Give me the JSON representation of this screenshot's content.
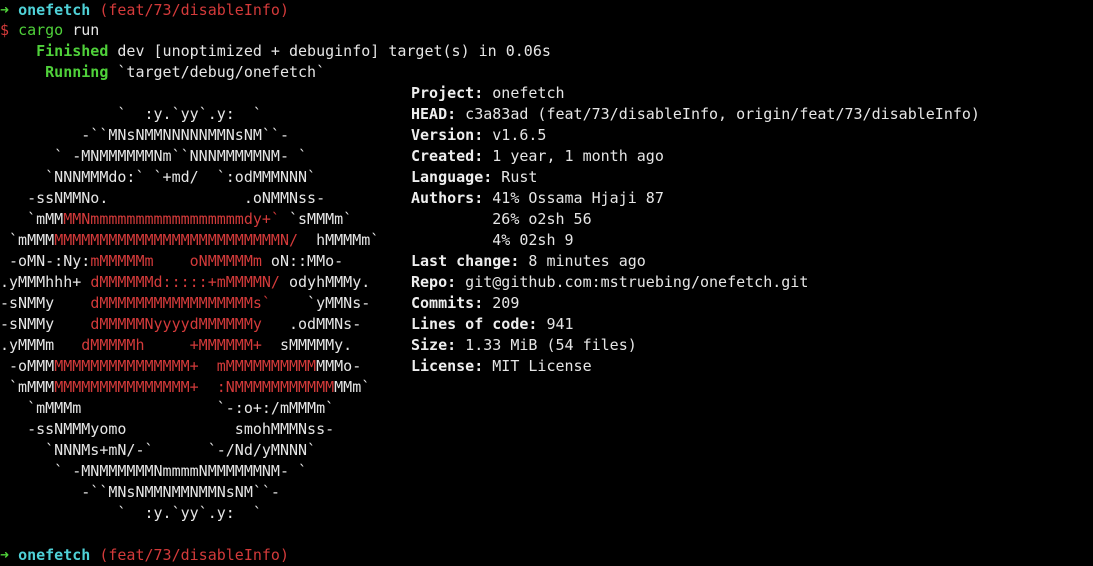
{
  "colors": {
    "background": "#000000",
    "text": "#e6e6e6",
    "prompt_arrow": "#4fd13a",
    "repo_name": "#4fd1d7",
    "branch": "#d33a3a",
    "cargo_status": "#4fd13a",
    "logo_accent": "#d33a3a"
  },
  "prompt_top": {
    "arrow": "➜",
    "repo": "onefetch",
    "branch": "(feat/73/disableInfo)"
  },
  "command": {
    "symbol": "$",
    "program": "cargo",
    "args": "run"
  },
  "cargo": {
    "finished_label": "Finished",
    "finished_text": "dev [unoptimized + debuginfo] target(s) in 0.06s",
    "running_label": "Running",
    "running_text": "`target/debug/onefetch`"
  },
  "logo_rows": [
    {
      "a": "             `  :y.`yy`.y:  `",
      "b": "",
      "c": ""
    },
    {
      "a": "         -``MNsNMMNNNNNMMNsNM``-",
      "b": "",
      "c": ""
    },
    {
      "a": "      ` -MNMMMMMMNm``NNNMMMMMNM- `",
      "b": "",
      "c": ""
    },
    {
      "a": "     `NNNMMMdo:` `+md/  `:odMMMNNN`",
      "b": "",
      "c": ""
    },
    {
      "a": "   -ssNMMNo.               .oNMMNss-",
      "b": "",
      "c": ""
    },
    {
      "a": "   `mMM",
      "b": "MMNmmmmmmmmmmmmmmmmmdy+`",
      "c": " `sMMMm`"
    },
    {
      "a": " `mMMM",
      "b": "MMMMMMMMMMMMMMMMMMMMMMMMMN/",
      "c": "  hMMMMm`"
    },
    {
      "a": " -oMN-:Ny:",
      "b": "mMMMMMm    oNMMMMMm",
      "c": " oN::MMo-"
    },
    {
      "a": ".yMMMhhh+ ",
      "b": "dMMMMMMd:::::+mMMMMN/",
      "c": " odyhMMMy."
    },
    {
      "a": "-sNMMy    ",
      "b": "dMMMMMMMMMMMMMMMMMs`",
      "c": "    `yMMNs-"
    },
    {
      "a": "-sNMMy    ",
      "b": "dMMMMMNyyyydMMMMMMy",
      "c": "   .odMMNs-"
    },
    {
      "a": ".yMMMm   ",
      "b": "dMMMMMh     +MMMMMM+",
      "c": "  sMMMMMy."
    },
    {
      "a": " -oMMM",
      "b": "MMMMMMMMMMMMMMM+  mMMMMMMMMMM",
      "c": "MMMo-"
    },
    {
      "a": " `mMMM",
      "b": "MMMMMMMMMMMMMMM+  :NMMMMMMMMMMM",
      "c": "MMm`"
    },
    {
      "a": "   `mMMMm               `-:o+:/mMMMm`",
      "b": "",
      "c": ""
    },
    {
      "a": "   -ssNMMMyomo            smohMMMNss-",
      "b": "",
      "c": ""
    },
    {
      "a": "     `NNNMs+mN/-`      `-/Nd/yMNNN`",
      "b": "",
      "c": ""
    },
    {
      "a": "      ` -MNMMMMMMNmmmmNMMMMMMNM- `",
      "b": "",
      "c": ""
    },
    {
      "a": "         -``MNsNMMNMMNMMNsNM``-",
      "b": "",
      "c": ""
    },
    {
      "a": "             `  :y.`yy`.y:  `",
      "b": "",
      "c": ""
    }
  ],
  "info": [
    {
      "label": "Project:",
      "value": " onefetch"
    },
    {
      "label": "HEAD:",
      "value": " c3a83ad (feat/73/disableInfo, origin/feat/73/disableInfo)"
    },
    {
      "label": "Version:",
      "value": " v1.6.5"
    },
    {
      "label": "Created:",
      "value": " 1 year, 1 month ago"
    },
    {
      "label": "Language:",
      "value": " Rust"
    },
    {
      "label": "Authors:",
      "value": " 41% Ossama Hjaji 87"
    },
    {
      "label": "",
      "value": "         26% o2sh 56"
    },
    {
      "label": "",
      "value": "         4% 02sh 9"
    },
    {
      "label": "Last change:",
      "value": " 8 minutes ago"
    },
    {
      "label": "Repo:",
      "value": " git@github.com:mstruebing/onefetch.git"
    },
    {
      "label": "Commits:",
      "value": " 209"
    },
    {
      "label": "Lines of code:",
      "value": " 941"
    },
    {
      "label": "Size:",
      "value": " 1.33 MiB (54 files)"
    },
    {
      "label": "License:",
      "value": " MIT License"
    }
  ],
  "prompt_bottom": {
    "arrow": "➜",
    "repo": "onefetch",
    "branch": "(feat/73/disableInfo)"
  }
}
